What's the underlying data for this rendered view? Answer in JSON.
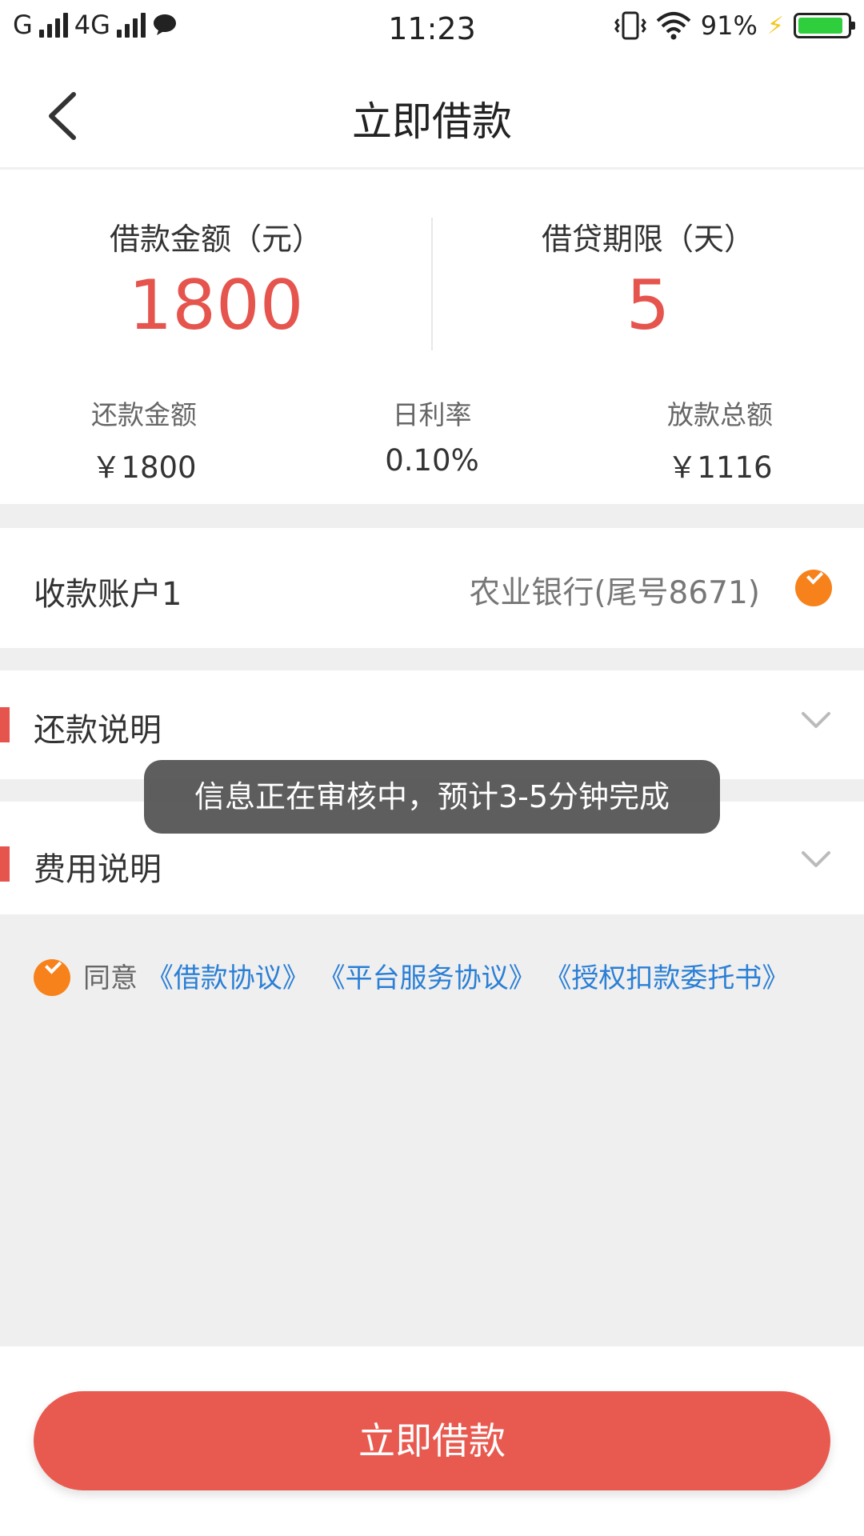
{
  "status_bar": {
    "carrier_left": "G",
    "network": "4G",
    "time": "11:23",
    "battery_percent": "91%",
    "battery_level": 0.91
  },
  "header": {
    "title": "立即借款"
  },
  "summary": {
    "amount_label": "借款金额（元）",
    "amount_value": "1800",
    "term_label": "借贷期限（天）",
    "term_value": "5",
    "repay_label": "还款金额",
    "repay_value": "￥1800",
    "rate_label": "日利率",
    "rate_value": "0.10%",
    "disburse_label": "放款总额",
    "disburse_value": "￥1116"
  },
  "account": {
    "label": "收款账户1",
    "value": "农业银行(尾号8671)"
  },
  "sections": [
    {
      "label": "还款说明"
    },
    {
      "label": "费用说明"
    }
  ],
  "agreement": {
    "prefix": "同意",
    "links": [
      "《借款协议》",
      "《平台服务协议》",
      "《授权扣款委托书》"
    ]
  },
  "toast": {
    "message": "信息正在审核中，预计3-5分钟完成"
  },
  "footer": {
    "button_label": "立即借款"
  },
  "colors": {
    "accent_red": "#e5544d",
    "button_red": "#e85a50",
    "check_orange": "#f7821b",
    "link_blue": "#2a7fd6",
    "background_gray": "#efefef"
  }
}
